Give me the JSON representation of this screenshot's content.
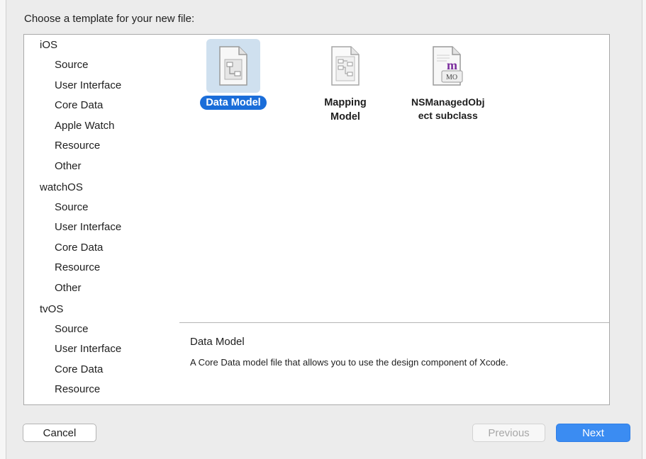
{
  "dialog": {
    "prompt": "Choose a template for your new file:"
  },
  "sidebar": {
    "platforms": [
      {
        "name": "iOS",
        "categories": [
          "Source",
          "User Interface",
          "Core Data",
          "Apple Watch",
          "Resource",
          "Other"
        ]
      },
      {
        "name": "watchOS",
        "categories": [
          "Source",
          "User Interface",
          "Core Data",
          "Resource",
          "Other"
        ]
      },
      {
        "name": "tvOS",
        "categories": [
          "Source",
          "User Interface",
          "Core Data",
          "Resource"
        ]
      }
    ]
  },
  "templates": [
    {
      "label": "Data Model",
      "selected": true,
      "icon": "data-model-icon"
    },
    {
      "label": "Mapping Model",
      "selected": false,
      "icon": "mapping-model-icon"
    },
    {
      "label": "NSManagedObject subclass",
      "label_line1": "NSManagedObj",
      "label_line2": "ect subclass",
      "selected": false,
      "icon": "managed-object-icon",
      "badge_letter": "m",
      "badge_text": "MO"
    }
  ],
  "description": {
    "title": "Data Model",
    "text": "A Core Data model file that allows you to use the design component of Xcode."
  },
  "buttons": {
    "cancel": "Cancel",
    "previous": "Previous",
    "next": "Next"
  },
  "colors": {
    "accent": "#1a6dd9",
    "next_button": "#3b8cf2",
    "selection_tile": "#cfe0ef"
  }
}
